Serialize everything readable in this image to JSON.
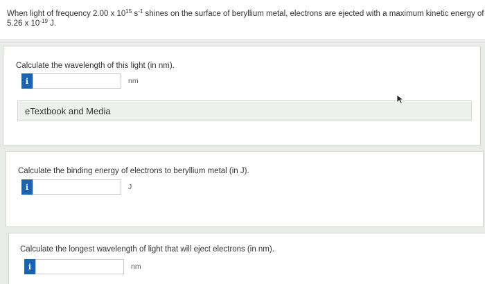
{
  "intro": {
    "part_a": "When light of frequency 2.00 x 10",
    "exp_a": "15",
    "part_b": " s",
    "exp_b": "-1",
    "part_c": " shines on the surface of beryllium metal, electrons are ejected with a maximum kinetic energy of 5.26 x 10",
    "exp_c": "-19",
    "part_d": " J."
  },
  "parts": [
    {
      "question": "Calculate the wavelength of this light (in nm).",
      "input_value": "",
      "unit": "nm",
      "info_label": "i"
    },
    {
      "question": "Calculate the binding energy of electrons to beryllium metal (in J).",
      "input_value": "",
      "unit": "J",
      "info_label": "i"
    },
    {
      "question": "Calculate the longest wavelength of light that will eject electrons (in nm).",
      "input_value": "",
      "unit": "nm",
      "info_label": "i"
    }
  ],
  "etextbook": {
    "label": "eTextbook and Media"
  },
  "icons": {
    "info": "info-icon",
    "cursor": "mouse-pointer-icon"
  },
  "colors": {
    "info_button": "#1a63b0",
    "panel_bg": "#ffffff",
    "page_bg": "#e9ebe9"
  }
}
